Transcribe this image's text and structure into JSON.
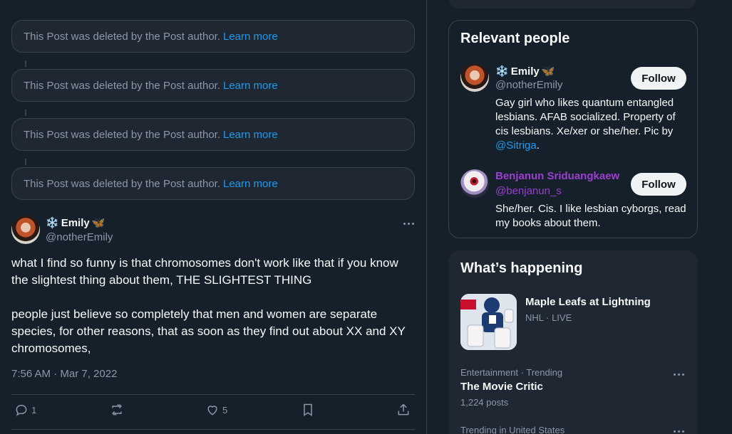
{
  "deleted_posts": [
    {
      "text": "This Post was deleted by the Post author.",
      "link": "Learn more"
    },
    {
      "text": "This Post was deleted by the Post author.",
      "link": "Learn more"
    },
    {
      "text": "This Post was deleted by the Post author.",
      "link": "Learn more"
    },
    {
      "text": "This Post was deleted by the Post author.",
      "link": "Learn more"
    }
  ],
  "post": {
    "author_name": "Emily",
    "author_emoji_left": "❄️",
    "author_emoji_right": "🦋",
    "handle": "@notherEmily",
    "paragraph1": "what I find so funny is that chromosomes don't work like that if you know the slightest thing about them, THE SLIGHTEST THING",
    "paragraph2": "people just believe so completely that men and women are separate species, for other reasons, that as soon as they find out about XX and XY chromosomes,",
    "timestamp": "7:56 AM · Mar 7, 2022",
    "actions": {
      "reply_count": "1",
      "retweet_count": "",
      "like_count": "5",
      "icons": [
        "reply-icon",
        "retweet-icon",
        "like-icon",
        "bookmark-icon",
        "share-icon"
      ]
    }
  },
  "relevant_people": {
    "title": "Relevant people",
    "people": [
      {
        "name": "Emily",
        "emoji_left": "❄️",
        "emoji_right": "🦋",
        "handle": "@notherEmily",
        "follow_label": "Follow",
        "bio": "Gay girl who likes quantum entangled lesbians. AFAB socialized. Property of cis lesbians. Xe/xer or she/her. Pic by ",
        "bio_link": "@Sitriga",
        "bio_end": "."
      },
      {
        "name": "Benjanun Sriduangkaew",
        "handle": "@benjanun_s",
        "follow_label": "Follow",
        "bio": "She/her. Cis. I like lesbian cyborgs, read my books about them."
      }
    ]
  },
  "whats_happening": {
    "title": "What’s happening",
    "trends": [
      {
        "headline": "Maple Leafs at Lightning",
        "meta": "NHL · LIVE"
      },
      {
        "category": "Entertainment · Trending",
        "headline": "The Movie Critic",
        "count": "1,224 posts"
      },
      {
        "category": "Trending in United States"
      }
    ]
  },
  "colors": {
    "background": "#15202b",
    "card": "#1e2732",
    "border": "#38444d",
    "accent": "#1d9bf0",
    "muted_text": "#8b98a5",
    "benjanun_name": "#9b3fcf"
  }
}
